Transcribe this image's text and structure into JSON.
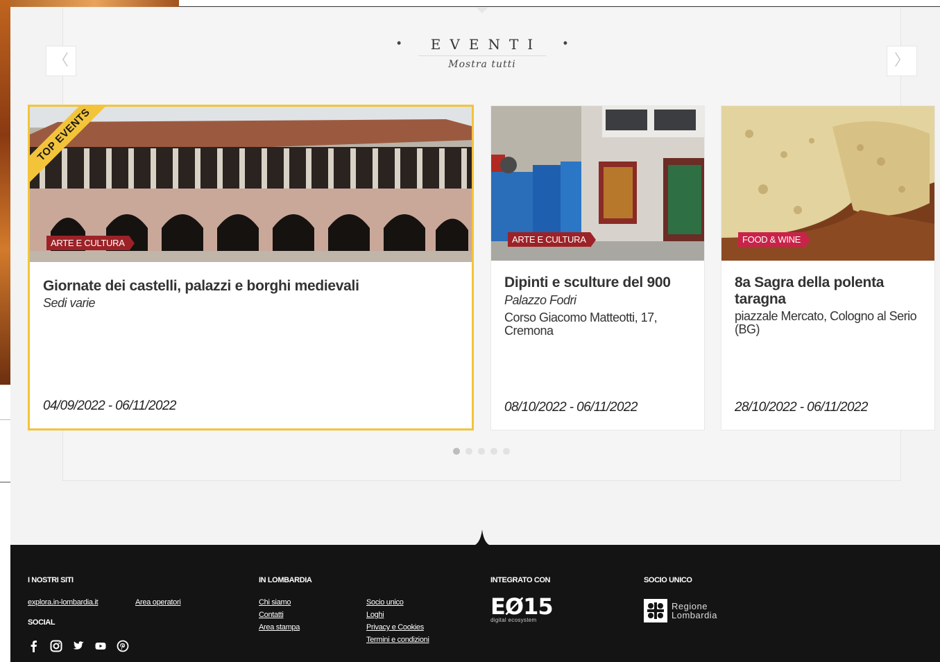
{
  "section": {
    "title": "EVENTI",
    "show_all": "Mostra tutti",
    "prev_glyph": "〈",
    "next_glyph": "〉"
  },
  "events": [
    {
      "ribbon": "TOP EVENTS",
      "category": "ARTE E CULTURA",
      "title": "Giornate dei castelli, palazzi e borghi medievali",
      "venue": "Sedi varie",
      "address": "",
      "dates": "04/09/2022 - 06/11/2022"
    },
    {
      "category": "ARTE E CULTURA",
      "title": "Dipinti e sculture del 900",
      "venue": "Palazzo Fodri",
      "address": "Corso Giacomo Matteotti, 17, Cremona",
      "dates": "08/10/2022 - 06/11/2022"
    },
    {
      "category": "FOOD & WINE",
      "title": "8a Sagra della polenta taragna",
      "venue": "",
      "address": "piazzale Mercato, Cologno al Serio (BG)",
      "dates": "28/10/2022 - 06/11/2022"
    }
  ],
  "pager": {
    "count": 5,
    "active": 1
  },
  "footer": {
    "our_sites_heading": "I NOSTRI SITI",
    "our_sites": [
      "explora.in-lombardia.it",
      "Area operatori"
    ],
    "social_heading": "SOCIAL",
    "social_icons": [
      "facebook-icon",
      "instagram-icon",
      "twitter-icon",
      "youtube-icon",
      "pinterest-icon"
    ],
    "in_lombardia_heading": "IN LOMBARDIA",
    "in_lombardia_col1": [
      "Chi siamo",
      "Contatti",
      "Area stampa"
    ],
    "in_lombardia_col2": [
      "Socio unico",
      "Loghi",
      "Privacy e Cookies",
      "Termini e condizioni"
    ],
    "integrated_heading": "INTEGRATO CON",
    "e015_logo": "EØ15",
    "e015_sub": "digital ecosystem",
    "sole_member_heading": "SOCIO UNICO",
    "regione_line1": "Regione",
    "regione_line2": "Lombardia"
  },
  "colors": {
    "featured_border": "#f3c43a",
    "badge_culture": "#9c2227",
    "badge_food": "#c9234a",
    "footer_bg": "#141414"
  }
}
